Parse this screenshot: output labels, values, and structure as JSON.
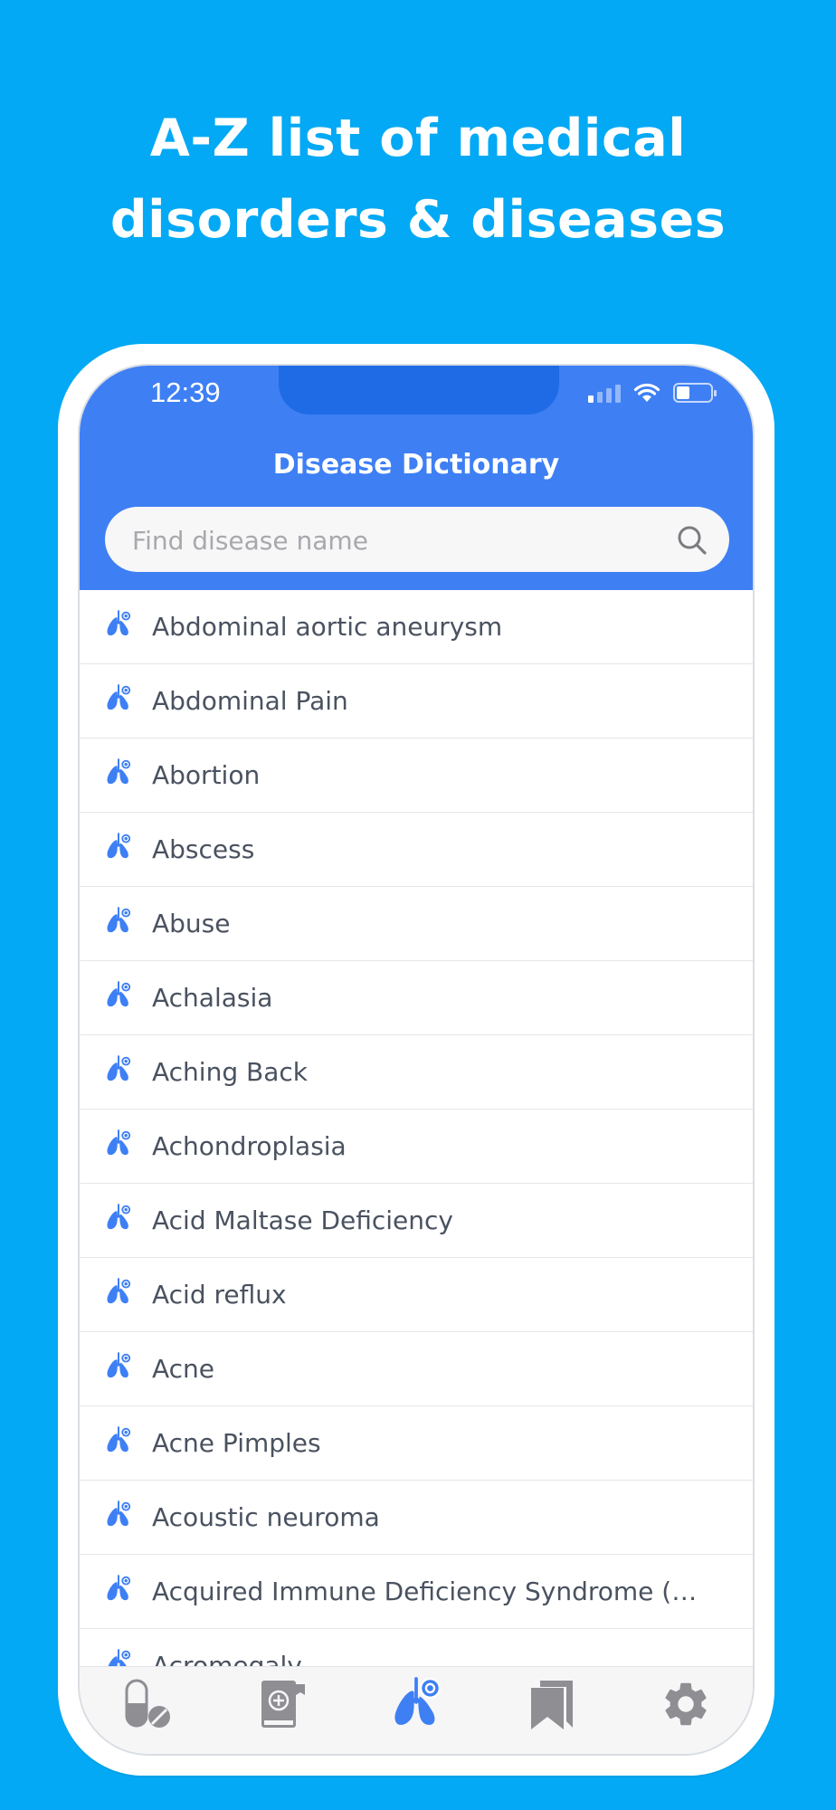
{
  "headline": {
    "line1": "A-Z list of medical",
    "line2": "disorders & diseases"
  },
  "status_bar": {
    "time": "12:39"
  },
  "app": {
    "title": "Disease Dictionary",
    "search_placeholder": "Find disease name"
  },
  "diseases": [
    {
      "label": "Abdominal aortic aneurysm"
    },
    {
      "label": "Abdominal Pain"
    },
    {
      "label": "Abortion"
    },
    {
      "label": "Abscess"
    },
    {
      "label": "Abuse"
    },
    {
      "label": "Achalasia"
    },
    {
      "label": "Aching Back"
    },
    {
      "label": "Achondroplasia"
    },
    {
      "label": "Acid Maltase Deficiency"
    },
    {
      "label": "Acid reflux"
    },
    {
      "label": "Acne"
    },
    {
      "label": "Acne Pimples"
    },
    {
      "label": "Acoustic neuroma"
    },
    {
      "label": "Acquired Immune Deficiency Syndrome (AI..."
    },
    {
      "label": "Acromegaly"
    }
  ],
  "tabs": [
    {
      "icon": "medicine-icon",
      "active": false
    },
    {
      "icon": "medical-book-icon",
      "active": false
    },
    {
      "icon": "lungs-icon",
      "active": true
    },
    {
      "icon": "bookmarks-icon",
      "active": false
    },
    {
      "icon": "gear-icon",
      "active": false
    }
  ],
  "colors": {
    "background": "#03a9f4",
    "header": "#3e7ff4",
    "accent_icon": "#3e7ff4",
    "inactive_icon": "#8e8e93",
    "list_text": "#4a5260"
  }
}
